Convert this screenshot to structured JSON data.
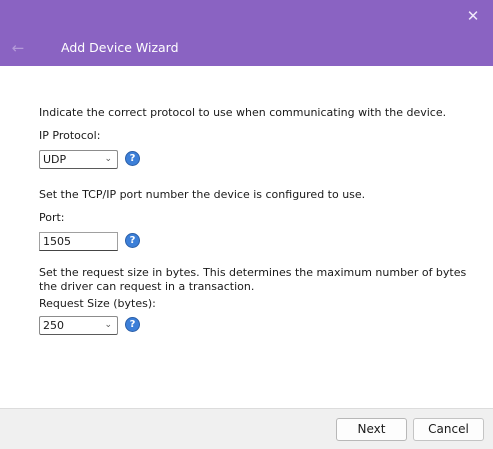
{
  "window": {
    "close_glyph": "✕"
  },
  "header": {
    "title": "Add Device Wizard",
    "back_glyph": "←"
  },
  "sections": [
    {
      "description": "Indicate the correct protocol to use when communicating with the device.",
      "label": "IP Protocol:",
      "value": "UDP",
      "control": "dropdown"
    },
    {
      "description": "Set the TCP/IP port number the device is configured to use.",
      "label": "Port:",
      "value": "1505",
      "control": "textbox"
    },
    {
      "description": "Set the request size in bytes. This determines the maximum number of bytes the driver can request in a transaction.",
      "label": "Request Size (bytes):",
      "value": "250",
      "control": "dropdown"
    }
  ],
  "help_glyph": "?",
  "chevron_glyph": "⌄",
  "footer": {
    "next_label": "Next",
    "cancel_label": "Cancel"
  },
  "colors": {
    "header_bg": "#8a63c2",
    "help_icon": "#3c7fd8",
    "footer_bg": "#f0f0f0"
  }
}
